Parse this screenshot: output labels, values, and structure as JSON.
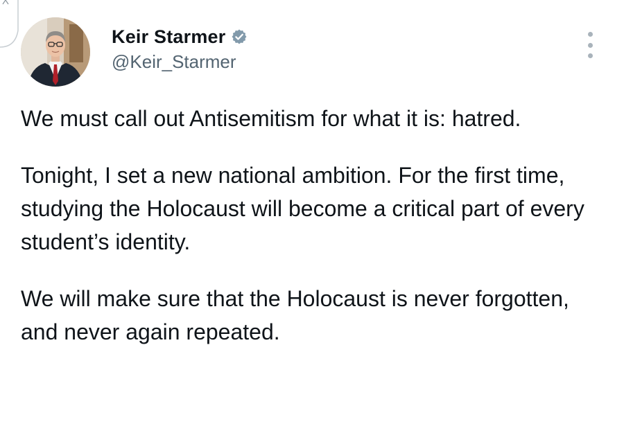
{
  "tweet": {
    "author": {
      "display_name": "Keir Starmer",
      "handle": "@Keir_Starmer",
      "verified": true,
      "verified_badge_icon": "verified-badge-icon",
      "verified_badge_color": "#829aab",
      "avatar_icon": "profile-photo"
    },
    "more_options_icon": "more-options-icon",
    "paragraphs": [
      "We must call out Antisemitism for what it is: hatred.",
      "Tonight, I set a new national ambition. For the first time, studying the Holocaust will become a critical part of every student’s identity.",
      "We will make sure that the Holocaust is never forgotten, and never again repeated."
    ]
  },
  "colors": {
    "text_primary": "#0f1419",
    "text_secondary": "#536471",
    "background": "#ffffff"
  }
}
